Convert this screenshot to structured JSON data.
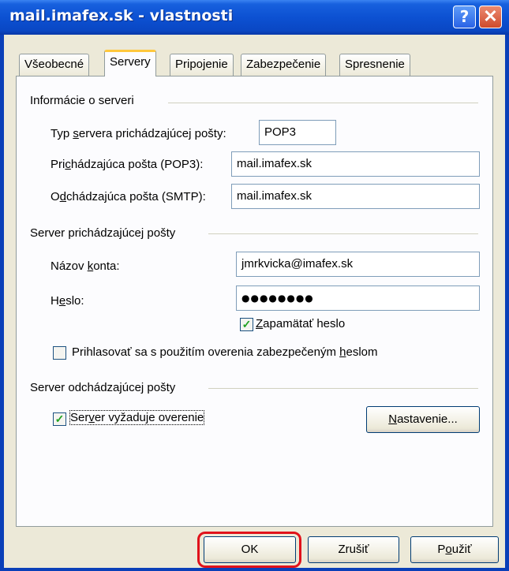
{
  "window": {
    "title": "mail.imafex.sk - vlastnosti",
    "help_glyph": "?",
    "close_glyph": "✕"
  },
  "tabs": [
    {
      "label": "Všeobecné",
      "active": false
    },
    {
      "label": "Servery",
      "active": true
    },
    {
      "label": "Pripojenie",
      "active": false
    },
    {
      "label": "Zabezpečenie",
      "active": false
    },
    {
      "label": "Spresnenie",
      "active": false
    }
  ],
  "server_info": {
    "group_label": "Informácie o serveri",
    "type_label_a": "Typ ",
    "type_label_u": "s",
    "type_label_b": "ervera prichádzajúcej pošty:",
    "type_value": "POP3",
    "incoming_label_a": "Pri",
    "incoming_label_u": "c",
    "incoming_label_b": "hádzajúca pošta (POP3):",
    "incoming_value": "mail.imafex.sk",
    "outgoing_label_a": "O",
    "outgoing_label_u": "d",
    "outgoing_label_b": "chádzajúca pošta (SMTP):",
    "outgoing_value": "mail.imafex.sk"
  },
  "incoming_server": {
    "group_label": "Server prichádzajúcej pošty",
    "account_label_a": "Názov ",
    "account_label_u": "k",
    "account_label_b": "onta:",
    "account_value": "jmrkvicka@imafex.sk",
    "password_label_a": "H",
    "password_label_u": "e",
    "password_label_b": "slo:",
    "password_value": "●●●●●●●●",
    "remember_u": "Z",
    "remember_rest": "apamätať heslo",
    "remember_checked": true,
    "spa_text_a": "Prihlasovať sa s použitím overenia zabezpečeným ",
    "spa_text_u": "h",
    "spa_text_b": "eslom",
    "spa_checked": false
  },
  "outgoing_server": {
    "group_label": "Server odchádzajúcej pošty",
    "auth_text_a": "Ser",
    "auth_text_u": "v",
    "auth_text_b": "er vyžaduje overenie",
    "auth_checked": true,
    "settings_u": "N",
    "settings_rest": "astavenie..."
  },
  "buttons": {
    "ok": "OK",
    "cancel": "Zrušiť",
    "apply_a": "P",
    "apply_u": "o",
    "apply_b": "užiť"
  },
  "colors": {
    "highlight": "#e0121b",
    "check": "#21a121",
    "titlebar": "#0c51d2"
  }
}
